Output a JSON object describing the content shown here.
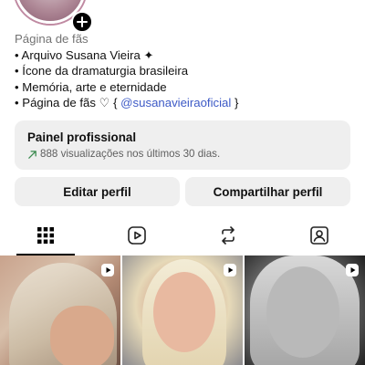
{
  "profile": {
    "category": "Página de fãs",
    "bio_lines": [
      "• Arquivo Susana Vieira ✦",
      "• Ícone da dramaturgia brasileira",
      "• Memória, arte e eternidade"
    ],
    "last_line_prefix": "• Página de fãs ♡ { ",
    "mention": "@susanavieiraoficial",
    "last_line_suffix": " }"
  },
  "professional_panel": {
    "title": "Painel profissional",
    "stats": "888 visualizações nos últimos 30 dias."
  },
  "actions": {
    "edit_label": "Editar perfil",
    "share_label": "Compartilhar perfil"
  },
  "tabs": [
    {
      "icon": "grid-icon",
      "active": true
    },
    {
      "icon": "reels-icon",
      "active": false
    },
    {
      "icon": "reposts-icon",
      "active": false
    },
    {
      "icon": "tagged-icon",
      "active": false
    }
  ],
  "grid_items": [
    {
      "type": "reel"
    },
    {
      "type": "reel"
    },
    {
      "type": "reel"
    }
  ],
  "colors": {
    "mention": "#3d5ac6",
    "card_background": "#efefef",
    "secondary_text": "#737373"
  }
}
